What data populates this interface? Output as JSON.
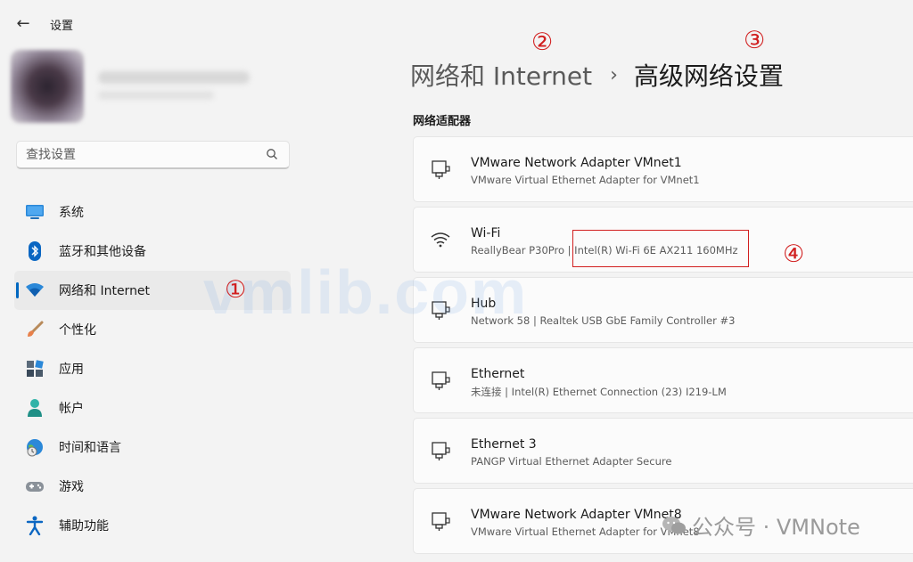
{
  "app": {
    "title": "设置",
    "back_icon": "back-arrow-icon"
  },
  "search": {
    "placeholder": "查找设置",
    "icon": "search-icon"
  },
  "sidebar": {
    "items": [
      {
        "label": "系统",
        "icon": "monitor-icon",
        "active": false
      },
      {
        "label": "蓝牙和其他设备",
        "icon": "bluetooth-icon",
        "active": false
      },
      {
        "label": "网络和 Internet",
        "icon": "wifi-icon",
        "active": true
      },
      {
        "label": "个性化",
        "icon": "brush-icon",
        "active": false
      },
      {
        "label": "应用",
        "icon": "apps-icon",
        "active": false
      },
      {
        "label": "帐户",
        "icon": "person-icon",
        "active": false
      },
      {
        "label": "时间和语言",
        "icon": "globe-clock-icon",
        "active": false
      },
      {
        "label": "游戏",
        "icon": "gamepad-icon",
        "active": false
      },
      {
        "label": "辅助功能",
        "icon": "accessibility-icon",
        "active": false
      }
    ]
  },
  "breadcrumb": {
    "parent": "网络和 Internet",
    "separator": "›",
    "current": "高级网络设置"
  },
  "section": {
    "title": "网络适配器"
  },
  "adapters": [
    {
      "name": "VMware Network Adapter VMnet1",
      "description": "VMware Virtual Ethernet Adapter for VMnet1",
      "icon": "ethernet-icon"
    },
    {
      "name": "Wi-Fi",
      "description": "ReallyBear P30Pro | Intel(R) Wi-Fi 6E AX211 160MHz",
      "icon": "wifi-icon"
    },
    {
      "name": "Hub",
      "description": "Network 58 | Realtek USB GbE Family Controller #3",
      "icon": "ethernet-icon"
    },
    {
      "name": "Ethernet",
      "description": "未连接 | Intel(R) Ethernet Connection (23) I219-LM",
      "icon": "ethernet-icon"
    },
    {
      "name": "Ethernet 3",
      "description": "PANGP Virtual Ethernet Adapter Secure",
      "icon": "ethernet-icon"
    },
    {
      "name": "VMware Network Adapter VMnet8",
      "description": "VMware Virtual Ethernet Adapter for VMnet8",
      "icon": "ethernet-icon"
    }
  ],
  "annotations": {
    "one": "①",
    "two": "②",
    "three": "③",
    "four": "④",
    "color": "#d11f1f"
  },
  "watermark": {
    "text": "vmlib.com"
  },
  "credit": {
    "text": "公众号 · VMNote"
  },
  "colors": {
    "accent": "#0067c0"
  }
}
